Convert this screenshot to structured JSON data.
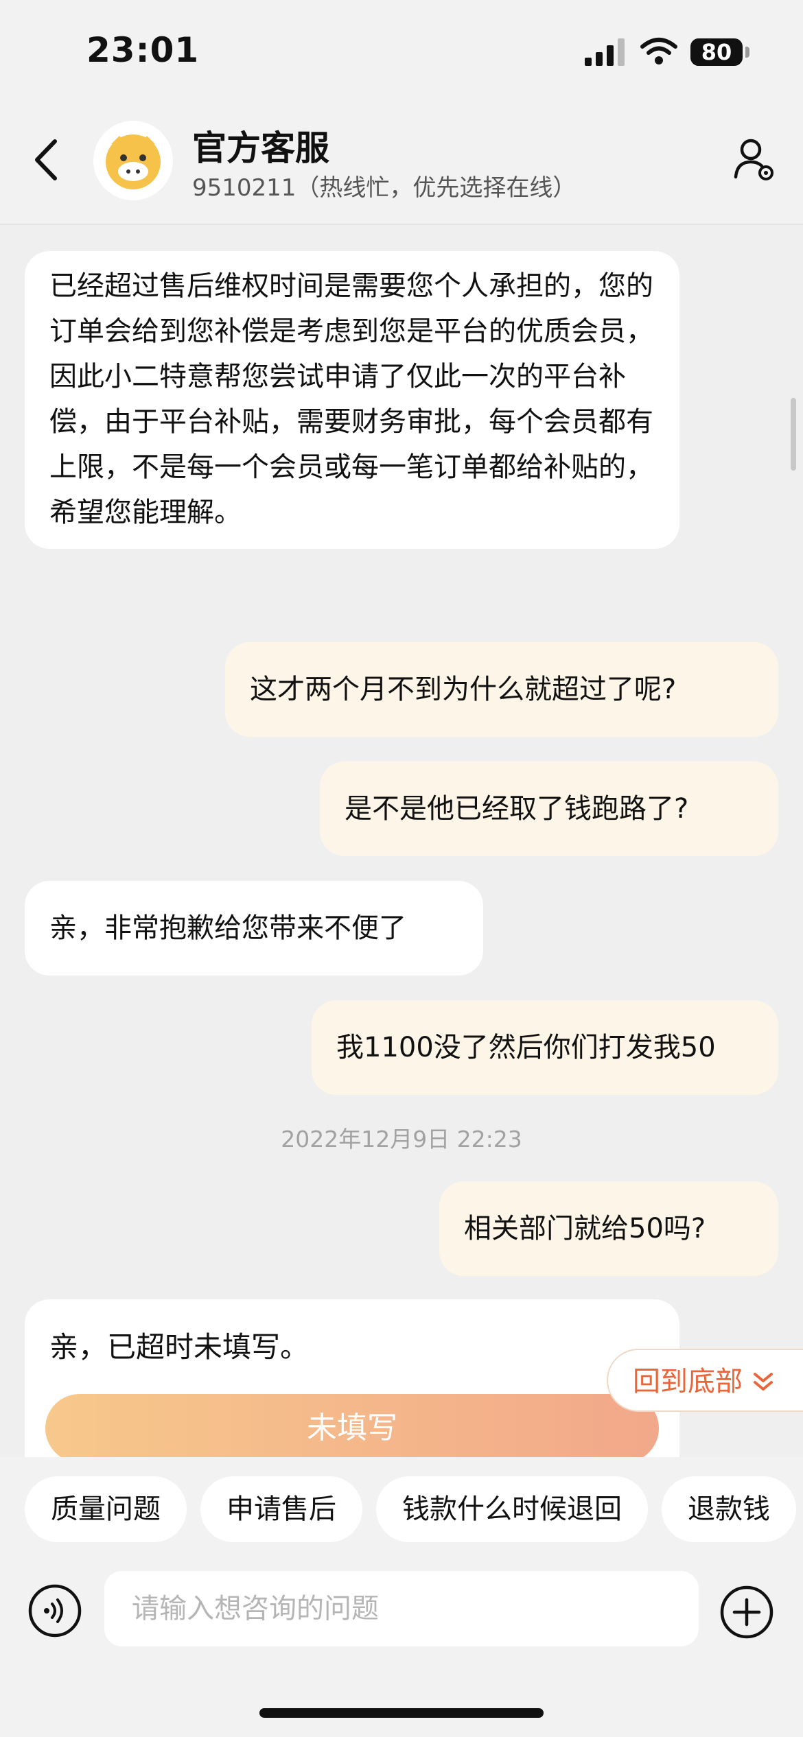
{
  "status": {
    "time": "23:01",
    "battery": "80"
  },
  "header": {
    "title": "官方客服",
    "subtitle": "9510211（热线忙，优先选择在线）"
  },
  "messages": [
    {
      "side": "left",
      "text": "已经超过售后维权时间是需要您个人承担的，您的订单会给到您补偿是考虑到您是平台的优质会员，因此小二特意帮您尝试申请了仅此一次的平台补偿，由于平台补贴，需要财务审批，每个会员都有上限，不是每一个会员或每一笔订单都给补贴的，希望您能理解。"
    },
    {
      "side": "right",
      "text": "这才两个月不到为什么就超过了呢?"
    },
    {
      "side": "right",
      "text": "是不是他已经取了钱跑路了?"
    },
    {
      "side": "left",
      "text": "亲，非常抱歉给您带来不便了"
    },
    {
      "side": "right",
      "text": "我1100没了然后你们打发我50"
    },
    {
      "side": "right",
      "text": "相关部门就给50吗?"
    }
  ],
  "timestamp": "2022年12月9日 22:23",
  "card": {
    "text": "亲，已超时未填写。",
    "button": "未填写"
  },
  "back_to_bottom": "回到底部",
  "quick_replies": [
    "质量问题",
    "申请售后",
    "钱款什么时候退回",
    "退款钱"
  ],
  "input": {
    "placeholder": "请输入想咨询的问题"
  }
}
